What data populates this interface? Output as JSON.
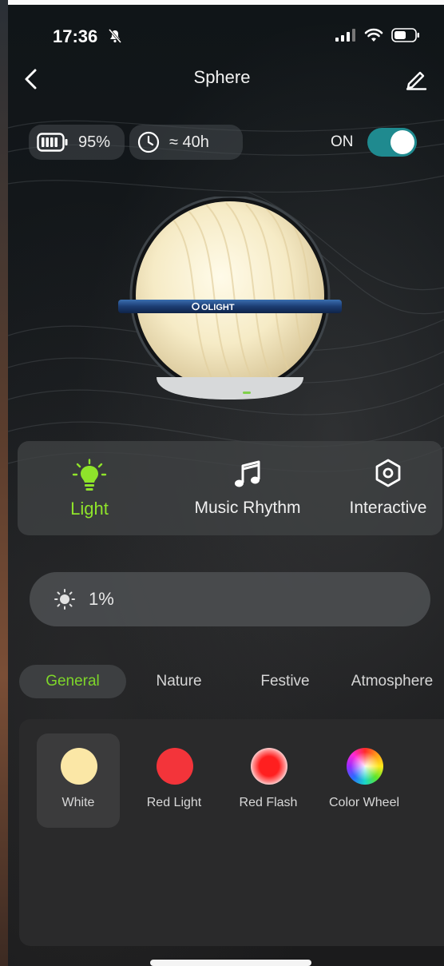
{
  "status_bar": {
    "time": "17:36"
  },
  "header": {
    "title": "Sphere"
  },
  "info": {
    "battery": "95%",
    "runtime": "≈ 40h",
    "power_label": "ON"
  },
  "lamp": {
    "brand": "OLIGHT"
  },
  "modes": [
    {
      "label": "Light",
      "active": true
    },
    {
      "label": "Music Rhythm",
      "active": false
    },
    {
      "label": "Interactive",
      "active": false
    }
  ],
  "brightness": {
    "value": "1%"
  },
  "categories": [
    {
      "label": "General",
      "active": true
    },
    {
      "label": "Nature",
      "active": false
    },
    {
      "label": "Festive",
      "active": false
    },
    {
      "label": "Atmosphere",
      "active": false
    }
  ],
  "effects": [
    {
      "label": "White",
      "selected": true
    },
    {
      "label": "Red Light",
      "selected": false
    },
    {
      "label": "Red Flash",
      "selected": false
    },
    {
      "label": "Color Wheel",
      "selected": false
    }
  ],
  "colors": {
    "accent_green": "#8fe32b",
    "toggle_teal": "#1f8a8f",
    "white_swatch": "#fbe7a6",
    "red_swatch": "#f3343a"
  }
}
